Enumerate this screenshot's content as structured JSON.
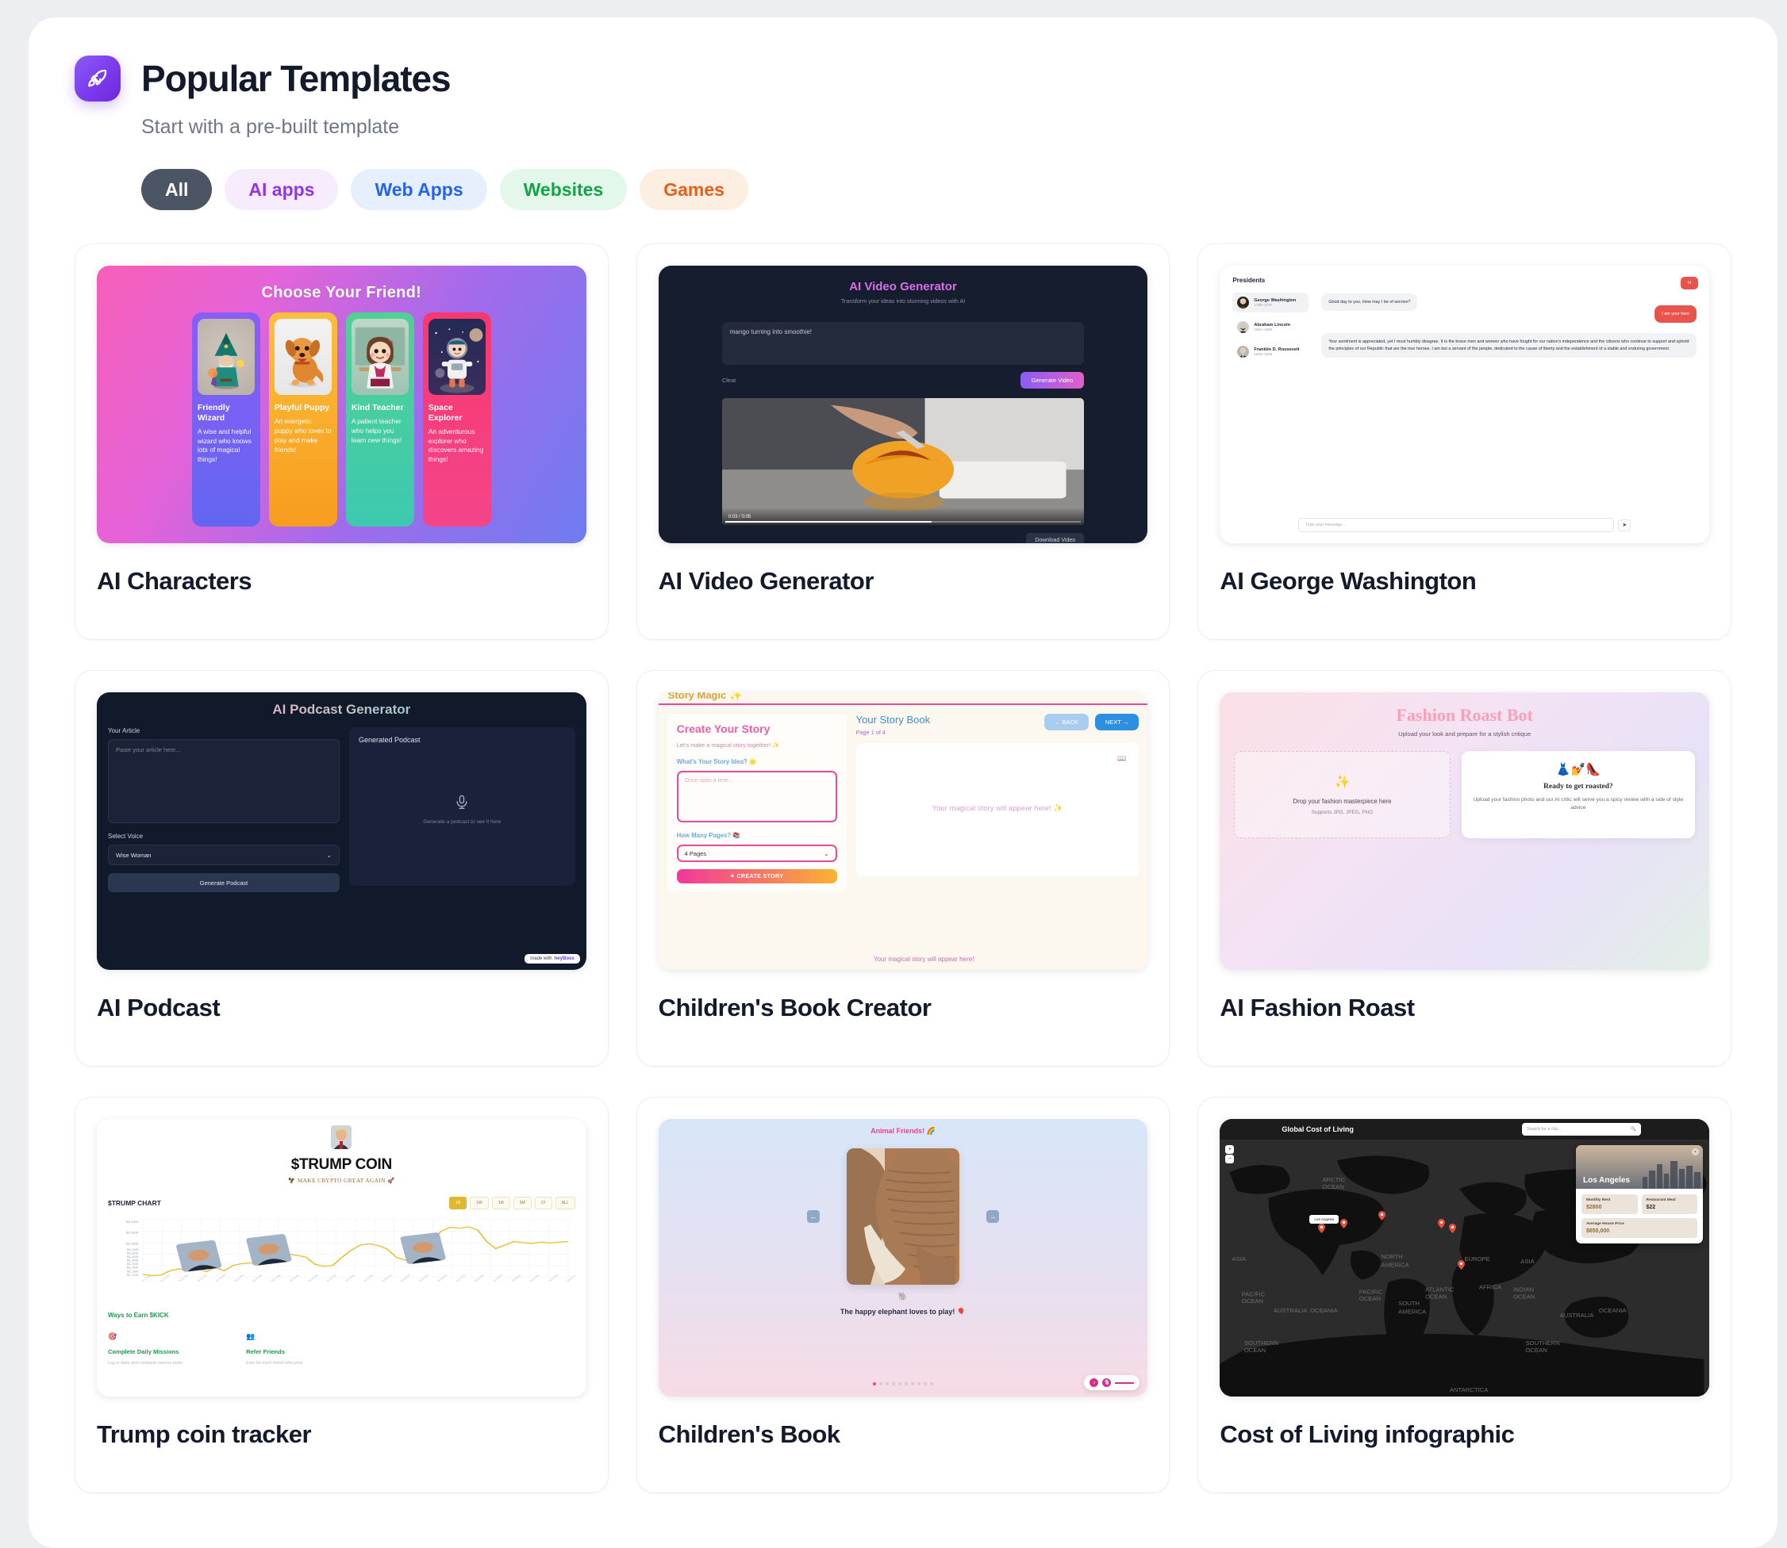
{
  "header": {
    "icon": "rocket-icon",
    "title": "Popular Templates",
    "subtitle": "Start with a pre-built template"
  },
  "filters": [
    {
      "label": "All",
      "active": true
    },
    {
      "label": "AI apps",
      "active": false
    },
    {
      "label": "Web Apps",
      "active": false
    },
    {
      "label": "Websites",
      "active": false
    },
    {
      "label": "Games",
      "active": false
    }
  ],
  "filter_colors": {
    "all_bg": "#4b5563",
    "all_fg": "#ffffff",
    "aiapps_bg": "#f7ecfd",
    "aiapps_fg": "#9333ea",
    "webapps_bg": "#e6effd",
    "webapps_fg": "#2563eb",
    "websites_bg": "#e3f7ea",
    "websites_fg": "#15a34a",
    "games_bg": "#fdeee2",
    "games_fg": "#e4601b"
  },
  "cards": [
    {
      "title": "AI Characters"
    },
    {
      "title": "AI Video Generator"
    },
    {
      "title": "AI George Washington"
    },
    {
      "title": "AI Podcast"
    },
    {
      "title": "Children's Book Creator"
    },
    {
      "title": "AI Fashion Roast"
    },
    {
      "title": "Trump coin tracker"
    },
    {
      "title": "Children's Book"
    },
    {
      "title": "Cost of Living infographic"
    }
  ],
  "thumb_ai_characters": {
    "heading": "Choose Your Friend!",
    "characters": [
      {
        "name": "Friendly Wizard",
        "desc": "A wise and helpful wizard who knows lots of magical things!"
      },
      {
        "name": "Playful Puppy",
        "desc": "An energetic puppy who loves to play and make friends!"
      },
      {
        "name": "Kind Teacher",
        "desc": "A patient teacher who helps you learn new things!"
      },
      {
        "name": "Space Explorer",
        "desc": "An adventurous explorer who discovers amazing things!"
      }
    ]
  },
  "thumb_ai_video": {
    "heading": "AI Video Generator",
    "subtitle": "Transform your ideas into stunning videos with AI",
    "prompt": "mango turning into smoothie!",
    "clear_label": "Clear",
    "generate_label": "Generate Video",
    "time": "0:03 / 0:05",
    "download_label": "Download Video"
  },
  "thumb_george_washington": {
    "list_title": "Presidents",
    "presidents": [
      {
        "name": "George Washington",
        "years": "1789–1797"
      },
      {
        "name": "Abraham Lincoln",
        "years": "1861–1865"
      },
      {
        "name": "Franklin D. Roosevelt",
        "years": "1933–1945"
      }
    ],
    "messages": [
      {
        "from": "bot",
        "text": "Good day to you. How may I be of service?"
      },
      {
        "from": "user",
        "text": "I am your hero"
      },
      {
        "from": "bot",
        "text": "Your sentiment is appreciated, yet I must humbly disagree. It is the brave men and women who have fought for our nation's independence and the citizens who continue to support and uphold the principles of our Republic that are the true heroes. I am but a servant of the people, dedicated to the cause of liberty and the establishment of a stable and enduring government."
      }
    ],
    "hi_button": "hi",
    "input_placeholder": "Type your message...",
    "send_icon": "send-icon"
  },
  "thumb_ai_podcast": {
    "heading": "AI Podcast Generator",
    "article_label": "Your Article",
    "article_placeholder": "Paste your article here...",
    "voice_label": "Select Voice",
    "voice_value": "Wise Woman",
    "generate_label": "Generate Podcast",
    "output_label": "Generated Podcast",
    "output_hint": "Generate a podcast to see it here",
    "mic_icon": "microphone-icon",
    "badge_prefix": "made with",
    "badge_brand": "heyBoss"
  },
  "thumb_childrens_book_creator": {
    "app_title": "Story Magic ✨",
    "panel_title": "Create Your Story",
    "panel_sub": "Let's make a magical story together! ✨",
    "idea_label": "What's Your Story Idea? 🌟",
    "idea_placeholder": "Once upon a time...",
    "pages_label": "How Many Pages? 📚",
    "pages_value": "4 Pages",
    "create_label": "✦ CREATE STORY",
    "book_title": "Your Story Book",
    "page_indicator": "Page 1 of 4",
    "back_label": "← BACK",
    "next_label": "NEXT →",
    "placeholder_text": "Your magical story will appear here! ✨",
    "footer_text": "Your magical story will appear here!"
  },
  "thumb_ai_fashion_roast": {
    "heading": "Fashion Roast Bot",
    "subtitle": "Upload your look and prepare for a stylish critique",
    "drop_title": "Drop your fashion masterpiece here",
    "drop_sub": "Supports JPG, JPEG, PNG",
    "drop_icon": "sparkles-icon",
    "card_emoji": "👗💅👠",
    "card_title": "Ready to get roasted?",
    "card_desc": "Upload your fashion photo and our AI critic will serve you a spicy review with a side of style advice"
  },
  "thumb_trump_coin": {
    "heading": "$TRUMP COIN",
    "subheading": "🦅 MAKE CRYPTO GREAT AGAIN 🚀",
    "chart_title": "$TRUMP CHART",
    "ranges": [
      "1D",
      "1W",
      "1M",
      "3M",
      "1Y",
      "ALL"
    ],
    "active_range": "1D",
    "ways_title": "Ways to Earn $KICK",
    "earn": [
      {
        "icon": "target-icon",
        "title": "Complete Daily Missions",
        "desc": "Log in daily and complete various tasks"
      },
      {
        "icon": "friends-icon",
        "title": "Refer Friends",
        "desc": "Earn for each friend who joins"
      }
    ],
    "chart_data": {
      "type": "line",
      "title": "$TRUMP CHART",
      "ylabel": "",
      "xlabel": "",
      "ylim": [
        1100,
        4000
      ],
      "ytick_labels": [
        "$4,000",
        "$3,800",
        "$2,800",
        "$2,000",
        "$1,800",
        "$1,600",
        "$1,500",
        "$1,400",
        "$1,300",
        "$1,200",
        "$1,100"
      ],
      "series": [
        {
          "name": "$TRUMP price",
          "color": "#e8c23a",
          "values": [
            1240,
            1180,
            1210,
            1420,
            1520,
            1480,
            1560,
            1380,
            1600,
            1420,
            1700,
            1790,
            1820,
            1800,
            1840,
            2180,
            2260,
            2200,
            2120,
            1760,
            1640,
            1700,
            2100,
            2450,
            2720,
            2780,
            2700,
            2520,
            2100,
            1960,
            2060,
            2500,
            2980,
            3420,
            3620,
            3560,
            3640,
            3480,
            2900,
            2540,
            2720,
            2900,
            2840,
            2800,
            2860,
            2820,
            2860,
            2900
          ]
        }
      ]
    }
  },
  "thumb_childrens_book": {
    "heading": "Animal Friends! 🌈",
    "caption": "The happy elephant loves to play! 🎈",
    "emoji": "🐘",
    "prev_icon": "arrow-left-icon",
    "next_icon": "arrow-right-icon",
    "dots_total": 10,
    "dots_active": 1
  },
  "thumb_cost_of_living": {
    "heading": "Global Cost of Living",
    "search_placeholder": "Search for a city...",
    "search_icon": "search-icon",
    "map_tooltip": "Los Angeles",
    "city": "Los Angeles",
    "zoom_in": "+",
    "zoom_out": "−",
    "stats": [
      {
        "label": "Monthly Rent",
        "value": "$2800"
      },
      {
        "label": "Restaurant Meal",
        "value": "$22"
      },
      {
        "label": "Average House Price",
        "value": "$850,000"
      }
    ],
    "continents": [
      "ASIA",
      "NORTH AMERICA",
      "EUROPE",
      "ASIA",
      "AFRICA",
      "SOUTH AMERICA",
      "AUSTRALIA",
      "OCEANIA",
      "ANTARCTICA"
    ]
  }
}
